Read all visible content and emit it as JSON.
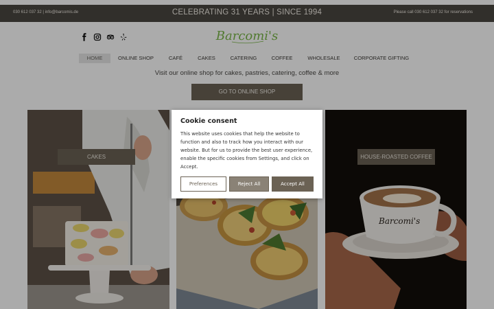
{
  "topbar": {
    "contact": "030 612 037 32 | info@barcomis.de",
    "tagline": "CELEBRATING 31 YEARS | SINCE 1994",
    "reservations": "Please call 030 612 037 32 for reservations"
  },
  "social": [
    "facebook-icon",
    "instagram-icon",
    "tripadvisor-icon",
    "yelp-icon"
  ],
  "logo": {
    "text": "Barcomi's",
    "color": "#7ab648"
  },
  "nav": {
    "items": [
      {
        "label": "HOME",
        "active": true
      },
      {
        "label": "ONLINE SHOP"
      },
      {
        "label": "CAFÉ"
      },
      {
        "label": "CAKES"
      },
      {
        "label": "CATERING"
      },
      {
        "label": "COFFEE"
      },
      {
        "label": "WHOLESALE"
      },
      {
        "label": "CORPORATE GIFTING"
      }
    ]
  },
  "intro": {
    "text": "Visit our online shop for cakes, pastries, catering, coffee & more",
    "button": "GO TO ONLINE SHOP"
  },
  "tiles": [
    {
      "label": "CAKES"
    },
    {
      "label": ""
    },
    {
      "label": "HOUSE-ROASTED COFFEE",
      "cup_text": "Barcomi's"
    }
  ],
  "cookie": {
    "title": "Cookie consent",
    "text": "This website uses cookies that help the website to function and also to track how you interact with our website. But for us to provide the best user experience, enable the specific cookies from Settings, and click on Accept.",
    "preferences": "Preferences",
    "reject": "Reject All",
    "accept": "Accept All"
  },
  "colors": {
    "topbar": "#4a4640",
    "button": "#6b6254",
    "logo_green": "#7ab648"
  }
}
